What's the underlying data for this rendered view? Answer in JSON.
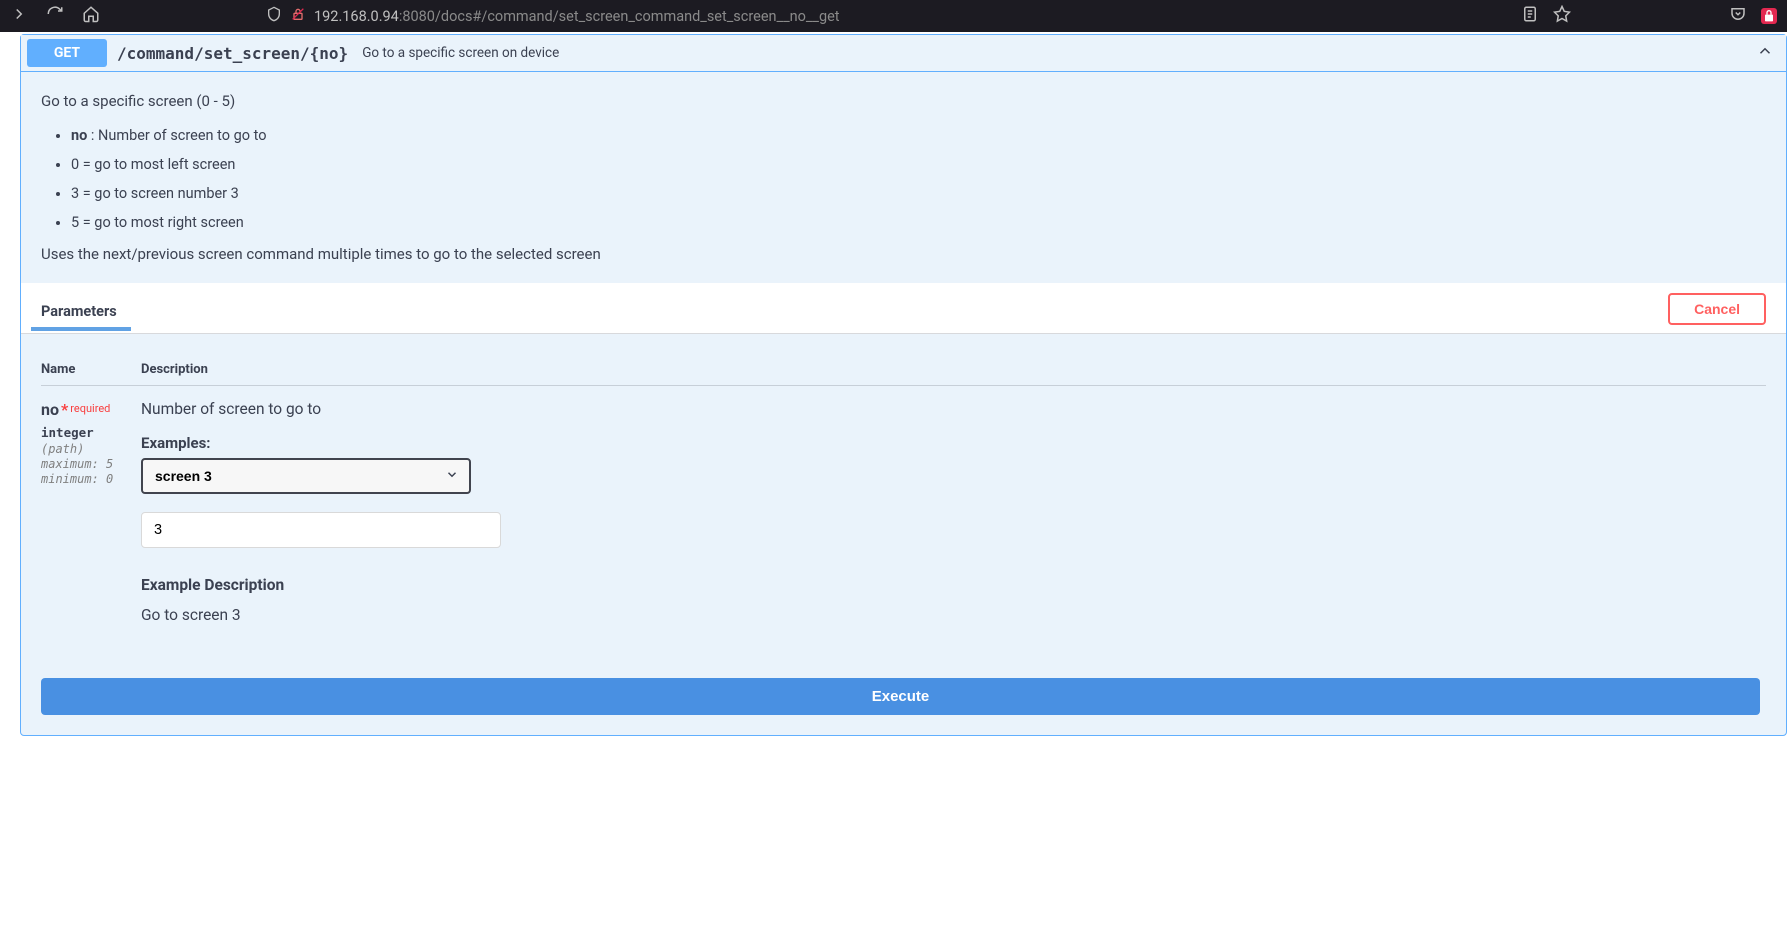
{
  "browser": {
    "url_host": "192.168.0.94",
    "url_port": ":8080",
    "url_path": "/docs#/command/set_screen_command_set_screen__no__get"
  },
  "op": {
    "method": "GET",
    "path": "/command/set_screen/{no}",
    "summary": "Go to a specific screen on device"
  },
  "description": {
    "intro": "Go to a specific screen (0 - 5)",
    "list": [
      {
        "bold": "no",
        "rest": " : Number of screen to go to"
      },
      {
        "bold": "",
        "rest": "0 = go to most left screen"
      },
      {
        "bold": "",
        "rest": "3 = go to screen number 3"
      },
      {
        "bold": "",
        "rest": "5 = go to most right screen"
      }
    ],
    "sub": "Uses the next/previous screen command multiple times to go to the selected screen"
  },
  "params_section": {
    "tab": "Parameters",
    "cancel": "Cancel",
    "col_name": "Name",
    "col_desc": "Description"
  },
  "param": {
    "name": "no",
    "required_star": "*",
    "required_label": "required",
    "type": "integer",
    "in": "(path)",
    "maximum": "maximum: 5",
    "minimum": "minimum: 0",
    "desc": "Number of screen to go to",
    "examples_label": "Examples:",
    "example_selected": "screen 3",
    "value": "3",
    "example_desc_label": "Example Description",
    "example_desc": "Go to screen 3"
  },
  "execute_label": "Execute"
}
